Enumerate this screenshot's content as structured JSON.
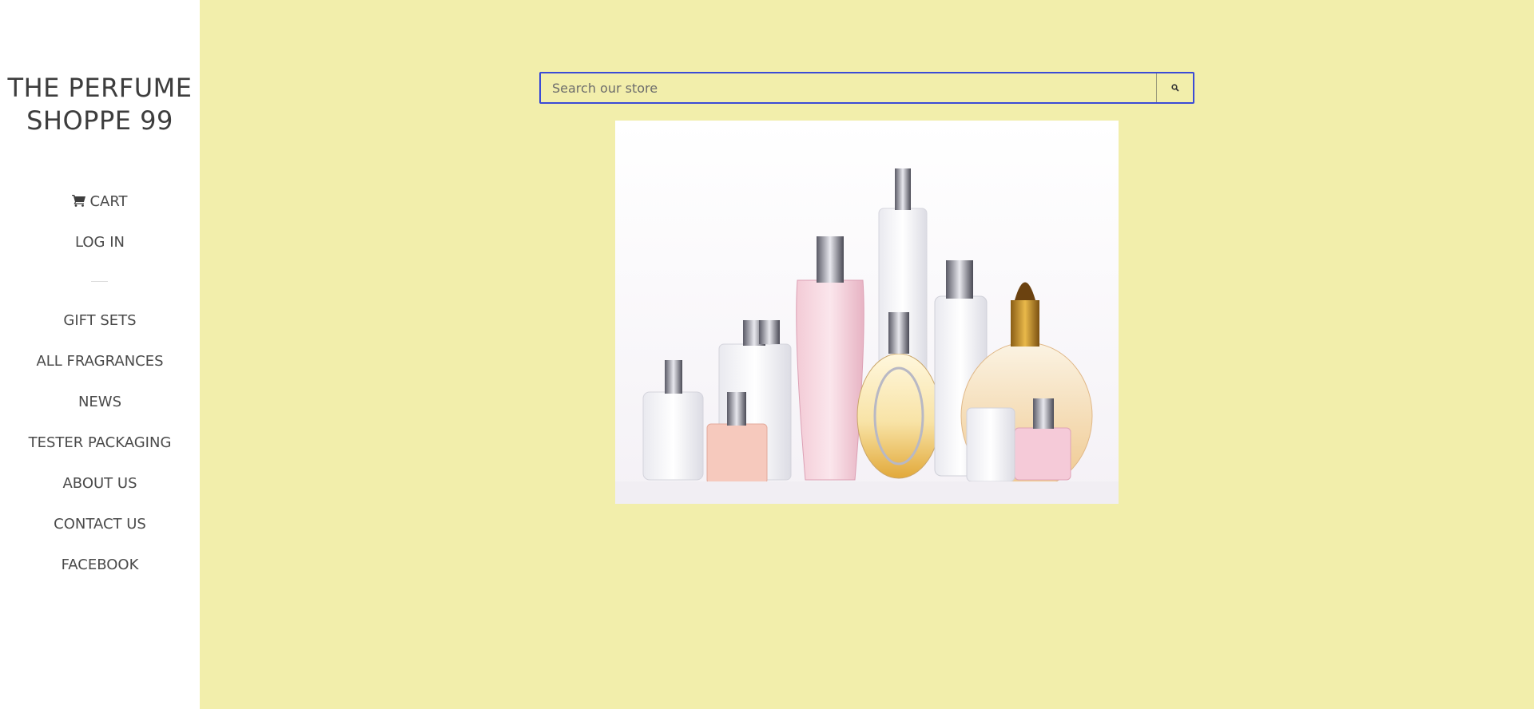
{
  "store": {
    "title_line1": "THE PERFUME",
    "title_line2": "SHOPPE 99"
  },
  "nav_top": [
    {
      "label": "CART",
      "icon": "cart-icon"
    },
    {
      "label": "LOG IN"
    }
  ],
  "nav_main": [
    {
      "label": "GIFT SETS"
    },
    {
      "label": "ALL FRAGRANCES"
    },
    {
      "label": "NEWS"
    },
    {
      "label": "TESTER PACKAGING"
    },
    {
      "label": "ABOUT US"
    },
    {
      "label": "CONTACT US"
    },
    {
      "label": "FACEBOOK"
    }
  ],
  "search": {
    "placeholder": "Search our store",
    "button_icon": "search-icon"
  },
  "hero": {
    "image": "perfume-bottles-image"
  },
  "colors": {
    "background": "#f2eeab",
    "sidebar": "#ffffff",
    "search_border": "#3b4bd6",
    "text": "#4a4a4a"
  }
}
